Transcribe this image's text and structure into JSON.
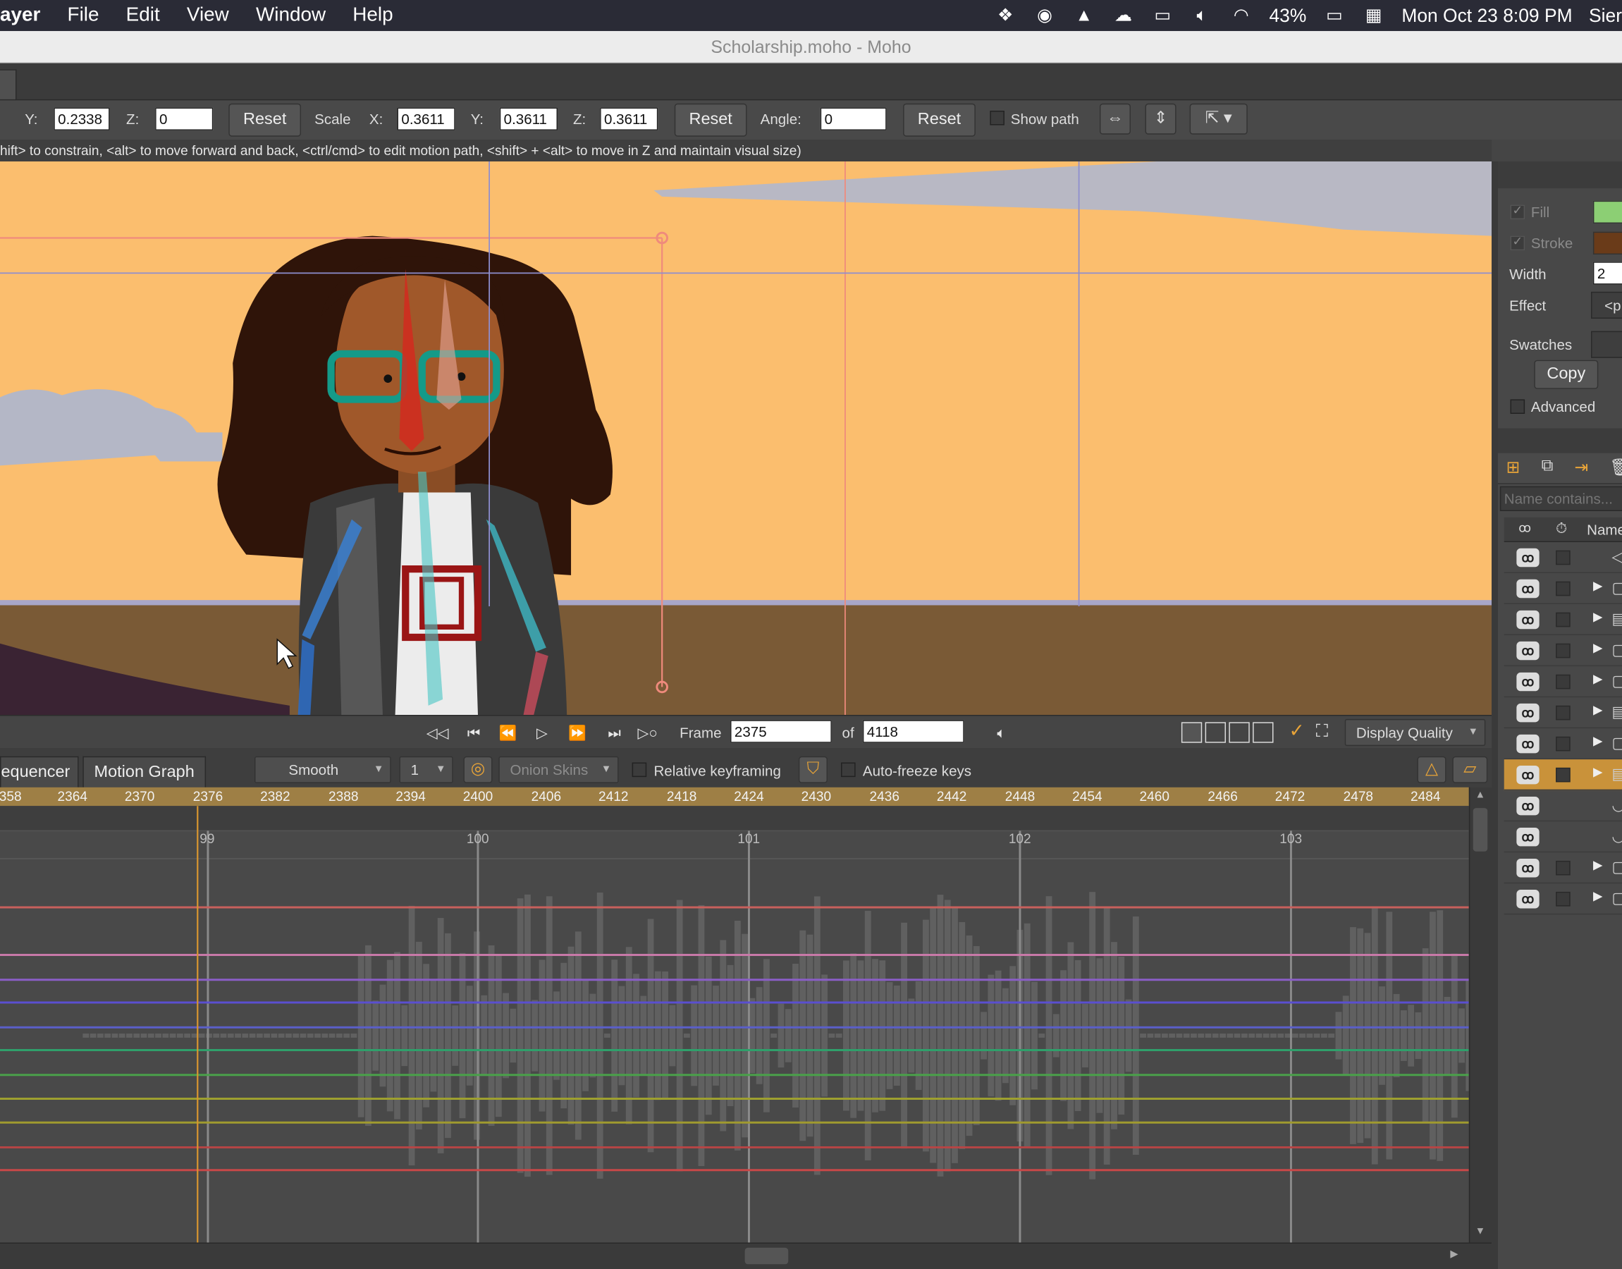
{
  "menubar": {
    "app": "ayer",
    "items": [
      "File",
      "Edit",
      "View",
      "Window",
      "Help"
    ],
    "battery": "43%",
    "clock": "Mon Oct 23  8:09 PM",
    "user": "Sier"
  },
  "window": {
    "title": "Scholarship.moho - Moho"
  },
  "toolbar": {
    "y_label": "Y:",
    "y_value": "0.2338",
    "z_label": "Z:",
    "z_value": "0",
    "reset1": "Reset",
    "scale_label": "Scale",
    "sx_label": "X:",
    "sx_value": "0.3611",
    "sy_label": "Y:",
    "sy_value": "0.3611",
    "sz_label": "Z:",
    "sz_value": "0.3611",
    "reset2": "Reset",
    "angle_label": "Angle:",
    "angle_value": "0",
    "reset3": "Reset",
    "show_path": "Show path",
    "show_path_checked": false
  },
  "hint": "hift> to constrain, <alt> to move forward and back, <ctrl/cmd> to edit motion path, <shift> + <alt> to move in Z and maintain visual size)",
  "playback": {
    "frame_label": "Frame",
    "frame_value": "2375",
    "of_label": "of",
    "total_frames": "4118",
    "display_quality": "Display Quality"
  },
  "timeline": {
    "tabs": [
      "equencer",
      "Motion Graph"
    ],
    "interp": "Smooth",
    "interval": "1",
    "onion": "Onion Skins",
    "relative": "Relative keyframing",
    "autofreeze": "Auto-freeze keys",
    "ruler": [
      "358",
      "2364",
      "2370",
      "2376",
      "2382",
      "2388",
      "2394",
      "2400",
      "2406",
      "2412",
      "2418",
      "2424",
      "2430",
      "2436",
      "2442",
      "2448",
      "2454",
      "2460",
      "2466",
      "2472",
      "2478",
      "2484"
    ],
    "seconds": [
      "99",
      "100",
      "101",
      "102",
      "103"
    ],
    "curve_colors": [
      "#c8605c",
      "#c879a8",
      "#8a5ec7",
      "#5a4fd0",
      "#5a5fc8",
      "#2fa06b",
      "#4aa04a",
      "#9ea02f",
      "#a09a2f",
      "#b84444",
      "#c84848"
    ]
  },
  "style_panel": {
    "fill_label": "Fill",
    "fill_color": "#8ccf74",
    "stroke_label": "Stroke",
    "stroke_color": "#6a3b19",
    "width_label": "Width",
    "width_value": "2",
    "effect_label": "Effect",
    "effect_value": "<p",
    "swatches_label": "Swatches",
    "copy_label": "Copy",
    "advanced_label": "Advanced"
  },
  "layers_panel": {
    "filter_placeholder": "Name contains...",
    "name_header": "Name",
    "selected_row": 7
  }
}
